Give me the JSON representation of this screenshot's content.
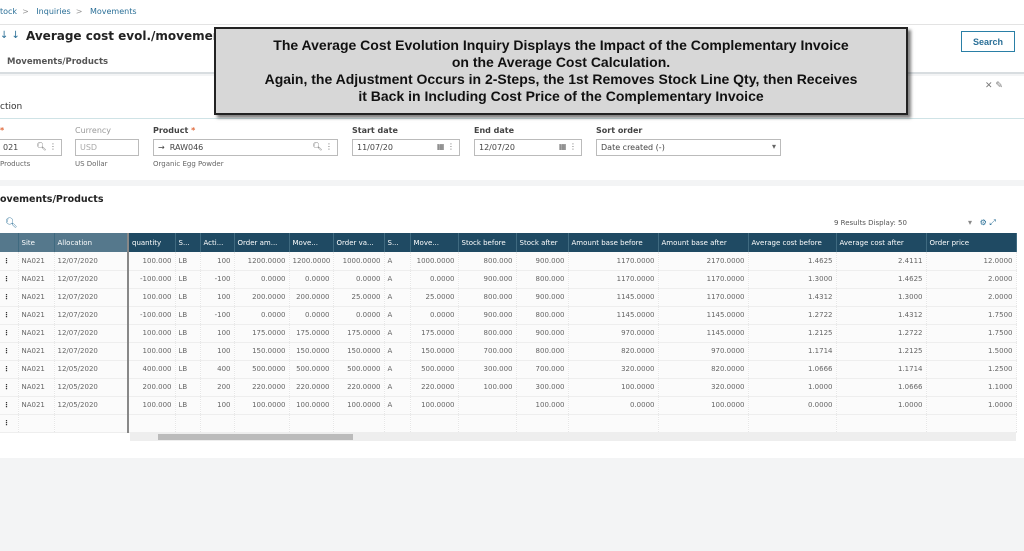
{
  "breadcrumb": [
    "tock",
    "Inquiries",
    "Movements"
  ],
  "header": {
    "title": "Average cost evol./movement",
    "subtab": "Movements/Products",
    "search_label": "Search"
  },
  "criteria": {
    "section": "ction",
    "site": {
      "value": "021",
      "sub": "Products"
    },
    "currency": {
      "label": "Currency",
      "value": "USD",
      "sub": "US Dollar"
    },
    "product": {
      "label": "Product",
      "value": "RAW046",
      "sub": "Organic Egg Powder"
    },
    "start_date": {
      "label": "Start date",
      "value": "11/07/20"
    },
    "end_date": {
      "label": "End date",
      "value": "12/07/20"
    },
    "sort_order": {
      "label": "Sort order",
      "value": "Date created (-)"
    }
  },
  "grid": {
    "title": "ovements/Products",
    "results": "9 Results  Display:  50",
    "columns": [
      "",
      "Site",
      "Allocation",
      "quantity",
      "S...",
      "Acti...",
      "Order am...",
      "Move...",
      "Order va...",
      "S...",
      "Move...",
      "Stock before",
      "Stock after",
      "Amount base before",
      "Amount base after",
      "Average cost before",
      "Average cost after",
      "Order price"
    ],
    "rows": [
      [
        "NA021",
        "12/07/2020",
        "100.000",
        "LB",
        "100",
        "1200.0000",
        "1200.0000",
        "1000.0000",
        "A",
        "1000.0000",
        "800.000",
        "900.000",
        "1170.0000",
        "2170.0000",
        "1.4625",
        "2.4111",
        "12.0000"
      ],
      [
        "NA021",
        "12/07/2020",
        "-100.000",
        "LB",
        "-100",
        "0.0000",
        "0.0000",
        "0.0000",
        "A",
        "0.0000",
        "900.000",
        "800.000",
        "1170.0000",
        "1170.0000",
        "1.3000",
        "1.4625",
        "2.0000"
      ],
      [
        "NA021",
        "12/07/2020",
        "100.000",
        "LB",
        "100",
        "200.0000",
        "200.0000",
        "25.0000",
        "A",
        "25.0000",
        "800.000",
        "900.000",
        "1145.0000",
        "1170.0000",
        "1.4312",
        "1.3000",
        "2.0000"
      ],
      [
        "NA021",
        "12/07/2020",
        "-100.000",
        "LB",
        "-100",
        "0.0000",
        "0.0000",
        "0.0000",
        "A",
        "0.0000",
        "900.000",
        "800.000",
        "1145.0000",
        "1145.0000",
        "1.2722",
        "1.4312",
        "1.7500"
      ],
      [
        "NA021",
        "12/07/2020",
        "100.000",
        "LB",
        "100",
        "175.0000",
        "175.0000",
        "175.0000",
        "A",
        "175.0000",
        "800.000",
        "900.000",
        "970.0000",
        "1145.0000",
        "1.2125",
        "1.2722",
        "1.7500"
      ],
      [
        "NA021",
        "12/07/2020",
        "100.000",
        "LB",
        "100",
        "150.0000",
        "150.0000",
        "150.0000",
        "A",
        "150.0000",
        "700.000",
        "800.000",
        "820.0000",
        "970.0000",
        "1.1714",
        "1.2125",
        "1.5000"
      ],
      [
        "NA021",
        "12/05/2020",
        "400.000",
        "LB",
        "400",
        "500.0000",
        "500.0000",
        "500.0000",
        "A",
        "500.0000",
        "300.000",
        "700.000",
        "320.0000",
        "820.0000",
        "1.0666",
        "1.1714",
        "1.2500"
      ],
      [
        "NA021",
        "12/05/2020",
        "200.000",
        "LB",
        "200",
        "220.0000",
        "220.0000",
        "220.0000",
        "A",
        "220.0000",
        "100.000",
        "300.000",
        "100.0000",
        "320.0000",
        "1.0000",
        "1.0666",
        "1.1000"
      ],
      [
        "NA021",
        "12/05/2020",
        "100.000",
        "LB",
        "100",
        "100.0000",
        "100.0000",
        "100.0000",
        "A",
        "100.0000",
        "",
        "100.000",
        "0.0000",
        "100.0000",
        "0.0000",
        "1.0000",
        "1.0000"
      ]
    ]
  },
  "callout": [
    "The Average Cost Evolution Inquiry Displays the Impact of the Complementary Invoice",
    "on the Average Cost Calculation.",
    "Again, the Adjustment Occurs in 2-Steps, the 1st Removes Stock Line Qty, then Receives",
    "it Back in Including Cost Price of the Complementary Invoice"
  ]
}
